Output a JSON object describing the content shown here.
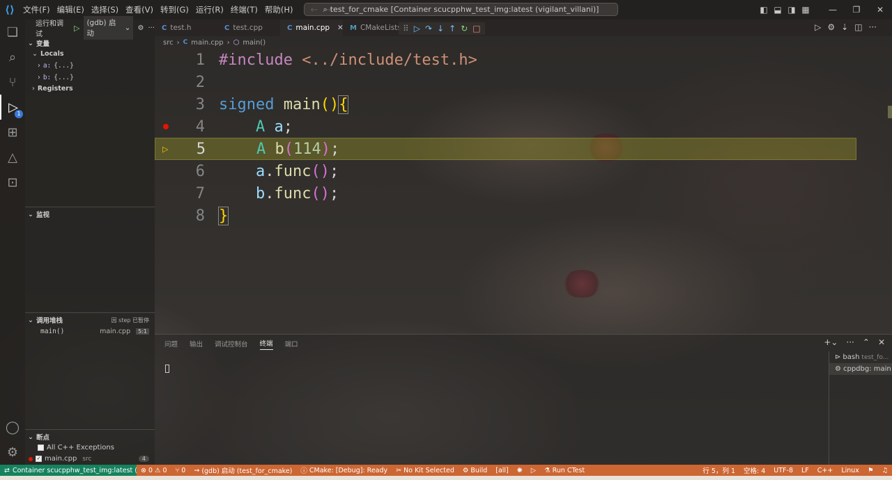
{
  "title_bar": {
    "menu": [
      "文件(F)",
      "编辑(E)",
      "选择(S)",
      "查看(V)",
      "转到(G)",
      "运行(R)",
      "终端(T)",
      "帮助(H)"
    ],
    "command_center": "test_for_cmake [Container scucpphw_test_img:latest (vigilant_villani)]"
  },
  "activity_bar": {
    "debug_badge": "1"
  },
  "sidebar": {
    "run_label": "运行和调试",
    "config_name": "(gdb) 启动",
    "variables_header": "变量",
    "locals_label": "Locals",
    "locals": [
      {
        "name": "a:",
        "value": "{...}"
      },
      {
        "name": "b:",
        "value": "{...}"
      }
    ],
    "registers_label": "Registers",
    "watch_header": "监视",
    "callstack_header": "调用堆栈",
    "callstack_status": "因 step 已暂停",
    "callstack_frames": [
      {
        "name": "main()",
        "file": "main.cpp",
        "pos": "5:1"
      }
    ],
    "breakpoints_header": "断点",
    "breakpoints": [
      {
        "label": "All C++ Exceptions",
        "path": "",
        "checked": false
      },
      {
        "label": "main.cpp",
        "path": "src",
        "checked": true,
        "count": "4"
      }
    ]
  },
  "tabs": [
    {
      "icon": "C",
      "label": "test.h",
      "active": false
    },
    {
      "icon": "C",
      "label": "test.cpp",
      "active": false
    },
    {
      "icon": "C",
      "label": "main.cpp",
      "active": true
    },
    {
      "icon": "M",
      "label": "CMakeLists",
      "active": false
    }
  ],
  "breadcrumb": [
    "src",
    "main.cpp",
    "main()"
  ],
  "code_lines": [
    {
      "n": "1"
    },
    {
      "n": "2"
    },
    {
      "n": "3"
    },
    {
      "n": "4"
    },
    {
      "n": "5"
    },
    {
      "n": "6"
    },
    {
      "n": "7"
    },
    {
      "n": "8"
    }
  ],
  "code": {
    "l1_include": "#include",
    "l1_path": "<../include/test.h>",
    "l3_signed": "signed",
    "l3_main": "main",
    "l4_type": "A",
    "l4_var": "a",
    "l5_type": "A",
    "l5_var": "b",
    "l5_num": "114",
    "l6_obj": "a",
    "l6_fn": "func",
    "l7_obj": "b",
    "l7_fn": "func"
  },
  "panel": {
    "tabs": [
      "问题",
      "输出",
      "调试控制台",
      "终端",
      "端口"
    ],
    "active_tab": "终端",
    "terminals": [
      {
        "name": "bash",
        "detail": "test_fo..."
      },
      {
        "name": "cppdbg: main",
        "detail": ""
      }
    ]
  },
  "status_bar": {
    "remote": "Container scucpphw_test_img:latest (vigi...",
    "errors": "0",
    "warnings": "0",
    "ports": "0",
    "debug_config": "(gdb) 启动 (test_for_cmake)",
    "cmake_status": "CMake: [Debug]: Ready",
    "kit": "No Kit Selected",
    "build": "Build",
    "target": "[all]",
    "ctest": "Run CTest",
    "position": "行 5，列 1",
    "spaces": "空格: 4",
    "encoding": "UTF-8",
    "eol": "LF",
    "language": "C++",
    "os": "Linux"
  },
  "colors": {
    "status_bar": "#cc6633",
    "remote": "#16825d",
    "breakpoint": "#e51400",
    "current_line": "#96912a"
  }
}
